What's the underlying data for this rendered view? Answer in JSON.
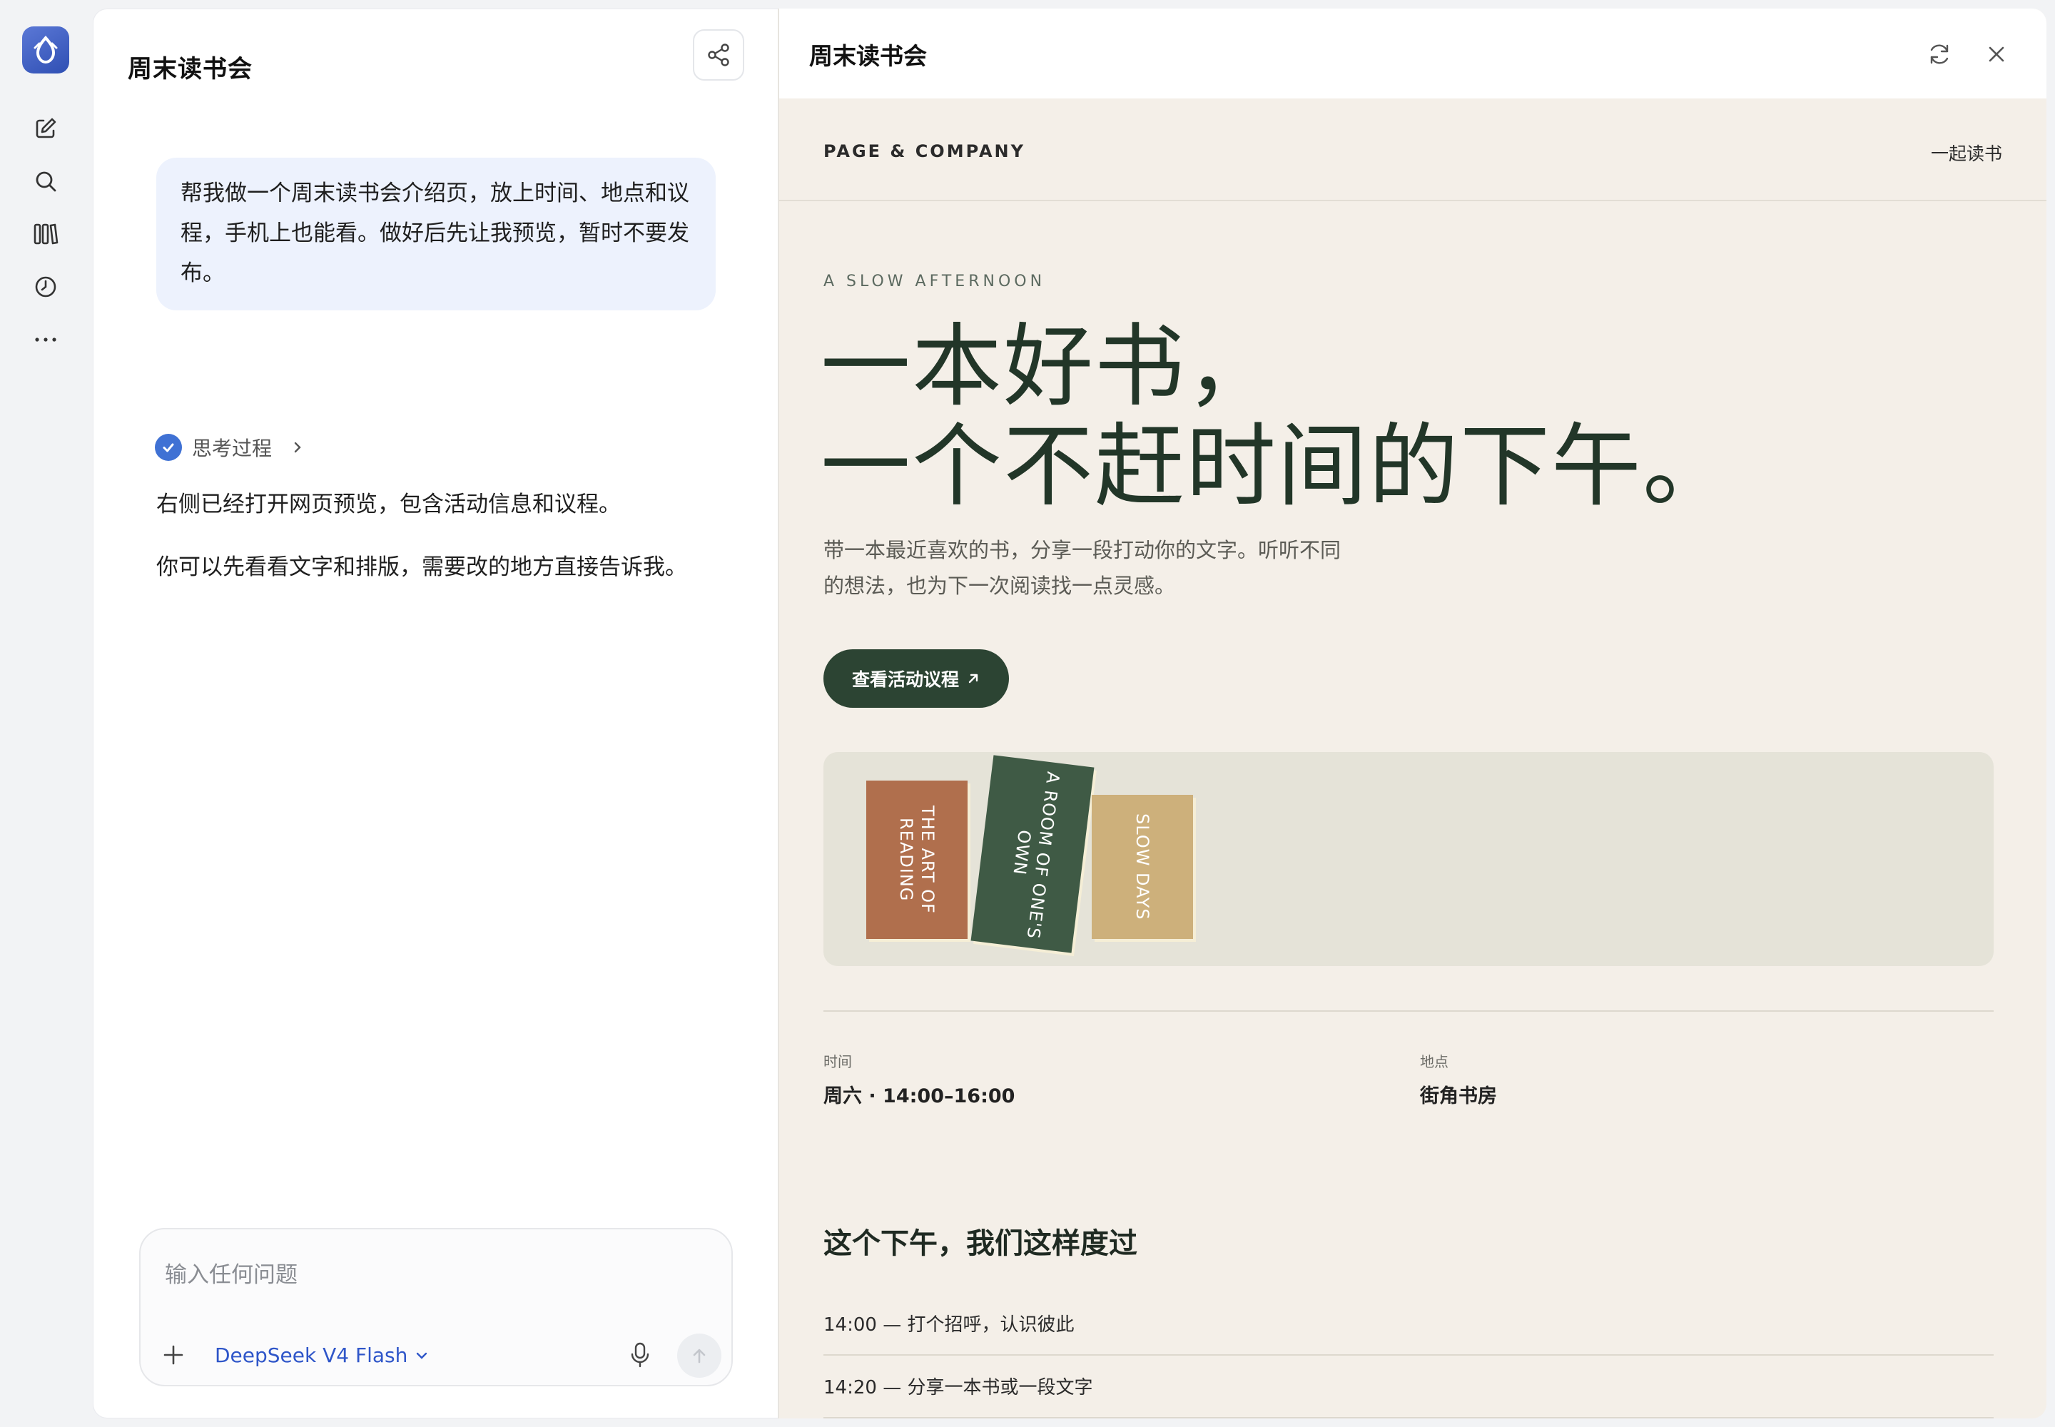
{
  "rail": {
    "logo": "app-logo",
    "items": [
      {
        "icon": "new-chat-icon"
      },
      {
        "icon": "search-icon"
      },
      {
        "icon": "library-icon"
      },
      {
        "icon": "history-icon"
      },
      {
        "icon": "more-icon"
      }
    ]
  },
  "chat": {
    "title": "周末读书会",
    "user_message": "帮我做一个周末读书会介绍页，放上时间、地点和议程，手机上也能看。做好后先让我预览，暂时不要发布。",
    "thinking_label": "思考过程",
    "assistant_paragraphs": [
      "右侧已经打开网页预览，包含活动信息和议程。",
      "你可以先看看文字和排版，需要改的地方直接告诉我。"
    ],
    "composer": {
      "placeholder": "输入任何问题",
      "model": "DeepSeek V4 Flash"
    }
  },
  "preview": {
    "title": "周末读书会",
    "site": {
      "brand": "PAGE & COMPANY",
      "nav_link": "一起读书",
      "eyebrow": "A SLOW AFTERNOON",
      "hero_lines": [
        "一本好书，",
        "一个不赶时间的下午。"
      ],
      "lead": "带一本最近喜欢的书，分享一段打动你的文字。听听不同的想法，也为下一次阅读找一点灵感。",
      "cta": "查看活动议程",
      "books": [
        "THE ART OF\nREADING",
        "A ROOM OF ONE'S\nOWN",
        "SLOW DAYS"
      ],
      "info": {
        "time_label": "时间",
        "time_value": "周六 · 14:00–16:00",
        "place_label": "地点",
        "place_value": "街角书房"
      },
      "agenda_title": "这个下午，我们这样度过",
      "agenda": [
        "14:00 — 打个招呼，认识彼此",
        "14:20 — 分享一本书或一段文字"
      ]
    }
  },
  "colors": {
    "accent": "#3f71d4",
    "preview_bg": "#f4efe8",
    "cta_bg": "#2c4433",
    "hero_text": "#223628"
  }
}
